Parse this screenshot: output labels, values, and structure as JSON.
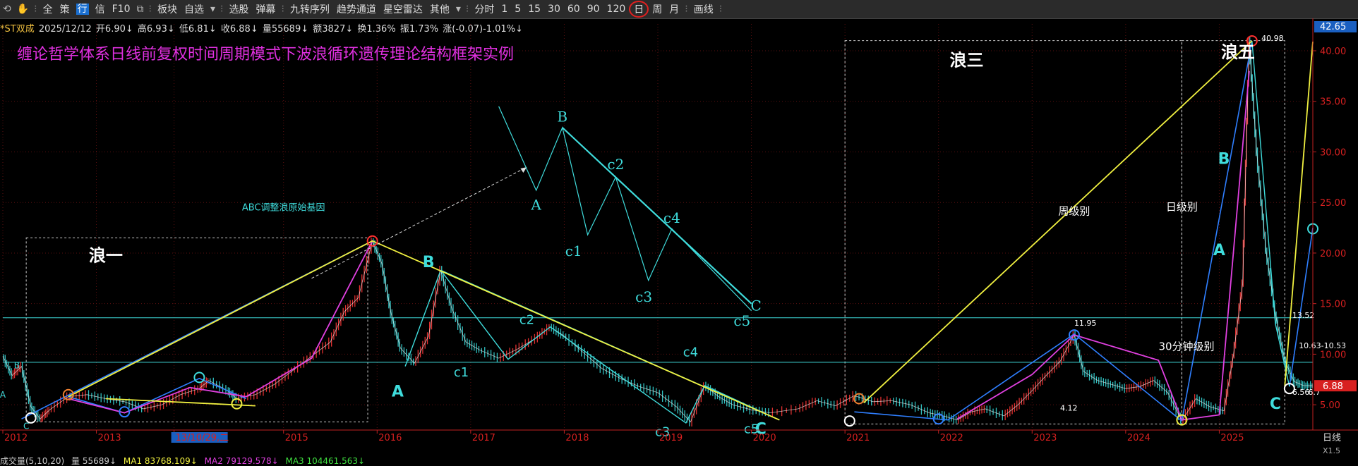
{
  "toolbar": {
    "items": [
      "全",
      "策",
      "行",
      "信",
      "F10",
      "板块",
      "自选",
      "选股",
      "弹幕",
      "九转序列",
      "趋势通道",
      "星空雷达",
      "其他",
      "分时",
      "1",
      "5",
      "15",
      "30",
      "60",
      "90",
      "120",
      "日",
      "周",
      "月",
      "画线"
    ],
    "dropdown_items": [
      "自选",
      "其他"
    ],
    "highlighted_item": "行",
    "selected_period": "日"
  },
  "infobar": {
    "name": "*ST双成",
    "date": "2025/12/12",
    "open": "开6.90↓",
    "high": "高6.93↓",
    "low": "低6.81↓",
    "close": "收6.88↓",
    "volume": "量55689↓",
    "amount": "额3827↓",
    "turnover": "换1.36%",
    "amplitude": "振1.73%",
    "change": "涨(-0.07)-1.01%↓"
  },
  "bottombar": {
    "title": "成交量(5,10,20)",
    "vol": "量 55689↓",
    "ma1": "MA1 83768.109↓",
    "ma2": "MA2 79129.578↓",
    "ma3": "MA3 104461.563↓"
  },
  "right_axis": {
    "top_badge": "42.65",
    "price_badge": "6.88",
    "period_label": "日线",
    "zoom_label": "X1.5"
  },
  "colors": {
    "background": "#000000",
    "axis_red": "#d82020",
    "yellow": "#f0f040",
    "cyan": "#3fdcdc",
    "blue": "#2f7fff",
    "magenta": "#e040e0",
    "title": "#e030e0",
    "badge_blue": "#1a5fc0"
  },
  "chart_data": {
    "type": "candlestick-line",
    "title": "缠论哲学体系日线前复权时间周期模式下波浪循环遗传理论结构框架实例",
    "ylim": [
      2.5,
      42.65
    ],
    "yticks": [
      5.0,
      10.0,
      15.0,
      20.0,
      25.0,
      30.0,
      35.0,
      40.0
    ],
    "xlim": [
      2012.0,
      2026.0
    ],
    "x_tick_labels": [
      {
        "year": 2012,
        "label": "2012"
      },
      {
        "year": 2013,
        "label": "2013"
      },
      {
        "year": 2013.83,
        "label": "13/10/29,二"
      },
      {
        "year": 2015,
        "label": "2015"
      },
      {
        "year": 2016,
        "label": "2016"
      },
      {
        "year": 2017,
        "label": "2017"
      },
      {
        "year": 2018,
        "label": "2018"
      },
      {
        "year": 2019,
        "label": "2019"
      },
      {
        "year": 2020,
        "label": "2020"
      },
      {
        "year": 2021,
        "label": "2021"
      },
      {
        "year": 2022,
        "label": "2022"
      },
      {
        "year": 2023,
        "label": "2023"
      },
      {
        "year": 2024,
        "label": "2024"
      },
      {
        "year": 2025,
        "label": "2025"
      }
    ],
    "horizontal_levels": [
      13.6,
      9.2
    ],
    "price_series": [
      [
        2012.0,
        9.8
      ],
      [
        2012.1,
        7.9
      ],
      [
        2012.2,
        8.8
      ],
      [
        2012.3,
        4.8
      ],
      [
        2012.4,
        3.6
      ],
      [
        2012.5,
        4.5
      ],
      [
        2012.7,
        5.8
      ],
      [
        2012.9,
        6.0
      ],
      [
        2013.1,
        5.6
      ],
      [
        2013.3,
        5.3
      ],
      [
        2013.5,
        4.6
      ],
      [
        2013.7,
        5.0
      ],
      [
        2013.9,
        6.0
      ],
      [
        2014.1,
        6.6
      ],
      [
        2014.2,
        7.4
      ],
      [
        2014.4,
        6.4
      ],
      [
        2014.5,
        5.6
      ],
      [
        2014.7,
        6.0
      ],
      [
        2014.9,
        7.0
      ],
      [
        2015.1,
        8.4
      ],
      [
        2015.3,
        9.8
      ],
      [
        2015.5,
        11.2
      ],
      [
        2015.65,
        14.2
      ],
      [
        2015.8,
        15.6
      ],
      [
        2015.95,
        21.2
      ],
      [
        2016.05,
        19.0
      ],
      [
        2016.15,
        14.0
      ],
      [
        2016.25,
        10.6
      ],
      [
        2016.4,
        9.1
      ],
      [
        2016.55,
        11.8
      ],
      [
        2016.68,
        18.3
      ],
      [
        2016.8,
        14.5
      ],
      [
        2016.95,
        11.2
      ],
      [
        2017.1,
        10.4
      ],
      [
        2017.3,
        9.6
      ],
      [
        2017.5,
        10.5
      ],
      [
        2017.7,
        11.6
      ],
      [
        2017.85,
        12.7
      ],
      [
        2018.0,
        11.8
      ],
      [
        2018.2,
        10.2
      ],
      [
        2018.4,
        8.6
      ],
      [
        2018.6,
        7.6
      ],
      [
        2018.8,
        6.8
      ],
      [
        2019.0,
        6.2
      ],
      [
        2019.2,
        4.8
      ],
      [
        2019.35,
        3.3
      ],
      [
        2019.5,
        6.9
      ],
      [
        2019.65,
        5.8
      ],
      [
        2019.8,
        5.0
      ],
      [
        2020.0,
        4.5
      ],
      [
        2020.2,
        4.2
      ],
      [
        2020.5,
        4.6
      ],
      [
        2020.7,
        5.4
      ],
      [
        2020.9,
        4.9
      ],
      [
        2021.1,
        5.9
      ],
      [
        2021.3,
        5.3
      ],
      [
        2021.5,
        5.4
      ],
      [
        2021.7,
        5.0
      ],
      [
        2021.9,
        4.2
      ],
      [
        2022.05,
        3.9
      ],
      [
        2022.2,
        3.5
      ],
      [
        2022.35,
        4.3
      ],
      [
        2022.5,
        4.6
      ],
      [
        2022.7,
        3.9
      ],
      [
        2022.85,
        5.0
      ],
      [
        2023.0,
        6.4
      ],
      [
        2023.15,
        7.9
      ],
      [
        2023.3,
        9.3
      ],
      [
        2023.45,
        11.9
      ],
      [
        2023.55,
        8.3
      ],
      [
        2023.7,
        7.4
      ],
      [
        2023.85,
        7.0
      ],
      [
        2024.0,
        6.6
      ],
      [
        2024.15,
        6.8
      ],
      [
        2024.3,
        7.4
      ],
      [
        2024.45,
        6.2
      ],
      [
        2024.6,
        3.4
      ],
      [
        2024.75,
        5.6
      ],
      [
        2024.9,
        4.8
      ],
      [
        2025.05,
        4.4
      ],
      [
        2025.15,
        9.8
      ],
      [
        2025.25,
        17.0
      ],
      [
        2025.32,
        40.9
      ],
      [
        2025.4,
        30.0
      ],
      [
        2025.5,
        20.2
      ],
      [
        2025.6,
        14.0
      ],
      [
        2025.7,
        9.4
      ],
      [
        2025.8,
        7.3
      ],
      [
        2025.9,
        6.9
      ],
      [
        2026.0,
        6.88
      ]
    ],
    "yellow_lines": [
      [
        [
          2012.7,
          5.8
        ],
        [
          2015.95,
          21.2
        ],
        [
          2020.3,
          3.5
        ]
      ],
      [
        [
          2021.2,
          5.2
        ],
        [
          2025.35,
          40.98
        ]
      ],
      [
        [
          2025.7,
          6.8
        ],
        [
          2026.0,
          40.9
        ]
      ],
      [
        [
          2013.1,
          5.6
        ],
        [
          2014.7,
          4.9
        ]
      ]
    ],
    "cyan_lines": [
      [
        [
          2016.68,
          18.3
        ],
        [
          2020.3,
          3.5
        ]
      ],
      [
        [
          2016.3,
          8.8
        ],
        [
          2016.68,
          18.3
        ]
      ],
      [
        [
          2016.68,
          18.3
        ],
        [
          2017.4,
          9.5
        ],
        [
          2017.85,
          12.7
        ],
        [
          2019.3,
          3.2
        ],
        [
          2019.5,
          6.9
        ],
        [
          2020.3,
          3.5
        ]
      ],
      [
        [
          2025.35,
          40.98
        ],
        [
          2025.6,
          13.0
        ],
        [
          2025.75,
          6.8
        ]
      ]
    ],
    "blue_lines": [
      [
        [
          2012.2,
          3.6
        ],
        [
          2015.95,
          21.2
        ]
      ],
      [
        [
          2012.7,
          5.8
        ],
        [
          2013.3,
          4.2
        ],
        [
          2014.1,
          7.6
        ],
        [
          2014.6,
          5.6
        ]
      ],
      [
        [
          2021.1,
          4.3
        ],
        [
          2022.1,
          3.5
        ],
        [
          2023.45,
          12.0
        ],
        [
          2024.6,
          3.4
        ]
      ],
      [
        [
          2024.6,
          3.4
        ],
        [
          2025.35,
          40.98
        ]
      ],
      [
        [
          2025.75,
          6.8
        ],
        [
          2026.0,
          22.5
        ]
      ]
    ],
    "magenta_lines": [
      [
        [
          2012.7,
          5.6
        ],
        [
          2013.3,
          4.2
        ],
        [
          2014.0,
          6.7
        ],
        [
          2014.6,
          5.8
        ],
        [
          2015.3,
          9.6
        ],
        [
          2015.95,
          21.2
        ]
      ],
      [
        [
          2022.2,
          3.6
        ],
        [
          2023.0,
          8.0
        ],
        [
          2023.45,
          11.9
        ],
        [
          2024.35,
          9.4
        ],
        [
          2024.6,
          3.5
        ],
        [
          2025.0,
          4.0
        ],
        [
          2025.32,
          38.0
        ]
      ]
    ],
    "circles": [
      {
        "x": 2012.3,
        "y": 3.7,
        "color": "white"
      },
      {
        "x": 2012.7,
        "y": 6.0,
        "color": "orange"
      },
      {
        "x": 2013.3,
        "y": 4.3,
        "color": "blue"
      },
      {
        "x": 2014.1,
        "y": 7.7,
        "color": "cyan"
      },
      {
        "x": 2014.5,
        "y": 5.1,
        "color": "yellow"
      },
      {
        "x": 2015.95,
        "y": 21.2,
        "color": "red"
      },
      {
        "x": 2021.05,
        "y": 3.4,
        "color": "white"
      },
      {
        "x": 2021.15,
        "y": 5.6,
        "color": "orange"
      },
      {
        "x": 2022.0,
        "y": 3.6,
        "color": "blue"
      },
      {
        "x": 2023.45,
        "y": 11.9,
        "color": "blue"
      },
      {
        "x": 2024.6,
        "y": 3.5,
        "color": "yellow"
      },
      {
        "x": 2025.35,
        "y": 40.98,
        "color": "red"
      },
      {
        "x": 2025.75,
        "y": 6.6,
        "color": "white"
      },
      {
        "x": 2026.0,
        "y": 22.4,
        "color": "cyan"
      }
    ],
    "boxes": [
      {
        "x0": 2012.25,
        "y0": 3.3,
        "x1": 2015.9,
        "y1": 21.5
      },
      {
        "x0": 2021.0,
        "y0": 3.1,
        "x1": 2024.6,
        "y1": 41.0
      },
      {
        "x0": 2024.6,
        "y0": 3.1,
        "x1": 2025.7,
        "y1": 41.0
      }
    ],
    "price_labels": [
      {
        "x": 2025.45,
        "y": 40.98,
        "text": "40.98"
      },
      {
        "x": 2023.45,
        "y": 12.8,
        "text": "11.95"
      },
      {
        "x": 2023.3,
        "y": 4.4,
        "text": "4.12"
      },
      {
        "x": 2025.78,
        "y": 13.6,
        "text": "13.52"
      },
      {
        "x": 2025.85,
        "y": 10.6,
        "text": "10.63-10.53"
      },
      {
        "x": 2025.78,
        "y": 6.0,
        "text": "6.56"
      },
      {
        "x": 2025.95,
        "y": 6.0,
        "text": "6.7"
      }
    ],
    "annotations": [
      {
        "text": "浪一",
        "x": 2013.1,
        "y": 19.2,
        "size": 24,
        "color": "white"
      },
      {
        "text": "浪三",
        "x": 2022.3,
        "y": 38.5,
        "size": 24,
        "color": "white"
      },
      {
        "text": "浪五",
        "x": 2025.2,
        "y": 39.3,
        "size": 24,
        "color": "white"
      },
      {
        "text": "ABC调整浪原始基因",
        "x": 2015.0,
        "y": 24.2,
        "size": 13,
        "color": "cyan"
      },
      {
        "text": "周级别",
        "x": 2023.45,
        "y": 23.8,
        "size": 15,
        "color": "white"
      },
      {
        "text": "日级别",
        "x": 2024.6,
        "y": 24.2,
        "size": 15,
        "color": "white"
      },
      {
        "text": "30分钟级别",
        "x": 2024.65,
        "y": 10.4,
        "size": 15,
        "color": "white"
      },
      {
        "text": "A",
        "x": 2012.0,
        "y": 5.7,
        "size": 12,
        "color": "cyan"
      },
      {
        "text": "B",
        "x": 2012.15,
        "y": 8.6,
        "size": 12,
        "color": "cyan"
      },
      {
        "text": "C",
        "x": 2012.25,
        "y": 2.6,
        "size": 12,
        "color": "cyan"
      },
      {
        "text": "A",
        "x": 2016.22,
        "y": 5.8,
        "size": 22,
        "color": "cyan"
      },
      {
        "text": "B",
        "x": 2016.55,
        "y": 18.6,
        "size": 22,
        "color": "cyan"
      },
      {
        "text": "C",
        "x": 2020.1,
        "y": 2.1,
        "size": 22,
        "color": "cyan"
      },
      {
        "text": "c1",
        "x": 2016.9,
        "y": 7.8,
        "size": 18,
        "color": "cyan"
      },
      {
        "text": "c2",
        "x": 2017.6,
        "y": 13.0,
        "size": 18,
        "color": "cyan"
      },
      {
        "text": "c3",
        "x": 2019.05,
        "y": 1.9,
        "size": 18,
        "color": "cyan"
      },
      {
        "text": "c4",
        "x": 2019.35,
        "y": 9.8,
        "size": 18,
        "color": "cyan"
      },
      {
        "text": "c5",
        "x": 2020.0,
        "y": 2.2,
        "size": 18,
        "color": "cyan"
      },
      {
        "text": "B",
        "x": 2025.05,
        "y": 28.8,
        "size": 22,
        "color": "cyan"
      },
      {
        "text": "A",
        "x": 2025.0,
        "y": 19.8,
        "size": 22,
        "color": "cyan"
      },
      {
        "text": "C",
        "x": 2025.6,
        "y": 4.6,
        "size": 22,
        "color": "cyan"
      }
    ],
    "inset": {
      "points": [
        [
          2017.3,
          34.5
        ],
        [
          2017.7,
          26.2
        ],
        [
          2017.98,
          32.4
        ],
        [
          2018.25,
          21.8
        ],
        [
          2018.55,
          27.5
        ],
        [
          2018.9,
          17.3
        ],
        [
          2019.15,
          22.4
        ],
        [
          2020.0,
          14.3
        ]
      ],
      "upper_line": [
        [
          2017.98,
          32.4
        ],
        [
          2020.0,
          15.0
        ]
      ],
      "arrow_from": [
        2015.3,
        17.5
      ],
      "arrow_to": [
        2017.6,
        28.5
      ],
      "labels": [
        {
          "text": "B",
          "x": 2017.98,
          "y": 33.0
        },
        {
          "text": "A",
          "x": 2017.7,
          "y": 24.3
        },
        {
          "text": "c1",
          "x": 2018.1,
          "y": 19.7
        },
        {
          "text": "c2",
          "x": 2018.55,
          "y": 28.3
        },
        {
          "text": "c3",
          "x": 2018.85,
          "y": 15.2
        },
        {
          "text": "c4",
          "x": 2019.15,
          "y": 23.0
        },
        {
          "text": "C",
          "x": 2020.05,
          "y": 14.3
        },
        {
          "text": "c5",
          "x": 2019.9,
          "y": 12.8
        }
      ]
    }
  }
}
